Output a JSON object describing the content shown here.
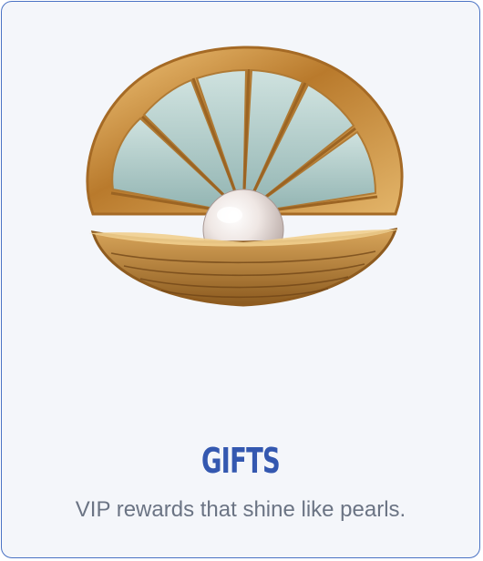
{
  "card": {
    "title": "GIFTS",
    "subtitle": "VIP rewards that shine like pearls.",
    "image_icon": "pearl-in-shell-icon"
  },
  "colors": {
    "card_border": "#4a72c4",
    "card_background": "#f4f6fa",
    "title": "#3458b0",
    "subtitle": "#6b7484",
    "shell_gold": "#c9913e",
    "shell_inner": "#a9c9c7",
    "pearl": "#efe9e6"
  }
}
